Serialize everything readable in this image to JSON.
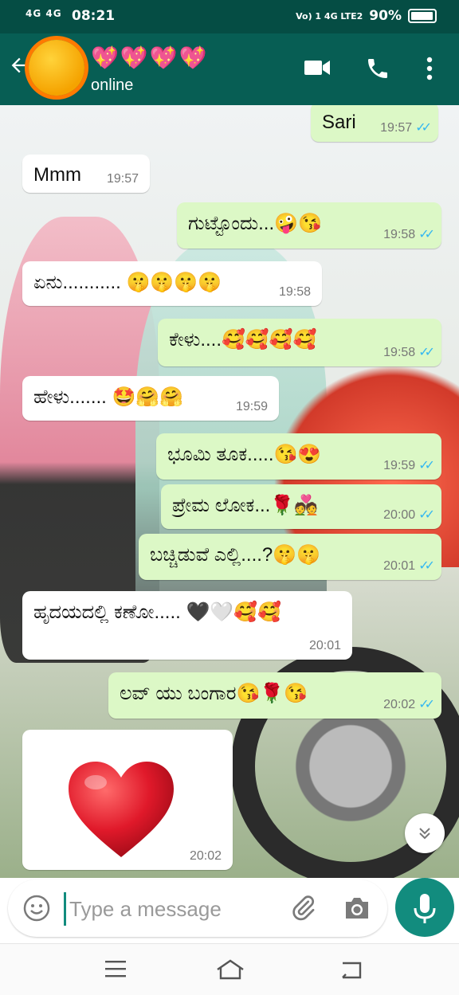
{
  "status_bar": {
    "signal": "4G 4G",
    "time": "08:21",
    "network": "Vo) 1 4G LTE2",
    "battery": "90%"
  },
  "header": {
    "contact_name": "💖💖💖💖",
    "status": "online"
  },
  "messages": [
    {
      "dir": "out",
      "text": "Sari",
      "time": "19:57",
      "read": true
    },
    {
      "dir": "in",
      "text": "Mmm",
      "time": "19:57"
    },
    {
      "dir": "out",
      "text": "ಗುಟ್ಟೊಂದು...🤪😘",
      "time": "19:58",
      "read": true
    },
    {
      "dir": "in",
      "text": "ಏನು........... 🤫🤫🤫🤫",
      "time": "19:58"
    },
    {
      "dir": "out",
      "text": "ಕೇಳು....🥰🥰🥰🥰",
      "time": "19:58",
      "read": true
    },
    {
      "dir": "in",
      "text": "ಹೇಳು....... 🤩🤗🤗",
      "time": "19:59"
    },
    {
      "dir": "out",
      "text": "ಭೂಮಿ ತೂಕ.....😘😍",
      "time": "19:59",
      "read": true
    },
    {
      "dir": "out",
      "text": "ಪ್ರೇಮ ಲೋಕ...🌹💑",
      "time": "20:00",
      "read": true
    },
    {
      "dir": "out",
      "text": "ಬಚ್ಚಿಡುವೆ ಎಲ್ಲಿ....?🤫🤫",
      "time": "20:01",
      "read": true
    },
    {
      "dir": "in",
      "text": "ಹೃದಯದಲ್ಲಿ ಕಣೋ..... 🖤🤍🥰🥰",
      "time": "20:01"
    },
    {
      "dir": "out",
      "text": "ಲವ್ ಯು ಬಂಗಾರ😘🌹😘",
      "time": "20:02",
      "read": true
    },
    {
      "dir": "in",
      "text": "",
      "time": "20:02",
      "sticker": "heart"
    }
  ],
  "composer": {
    "placeholder": "Type a message"
  },
  "colors": {
    "header": "#075e54",
    "status_bar": "#054d44",
    "outgoing": "#dcf8c6",
    "incoming": "#ffffff",
    "accent": "#128c7e",
    "read_ticks": "#34b7f1"
  },
  "icons": [
    "back-arrow-icon",
    "video-call-icon",
    "phone-icon",
    "more-options-icon",
    "emoji-icon",
    "attach-icon",
    "camera-icon",
    "mic-icon",
    "scroll-down-icon",
    "menu-icon",
    "home-icon",
    "back-icon"
  ]
}
